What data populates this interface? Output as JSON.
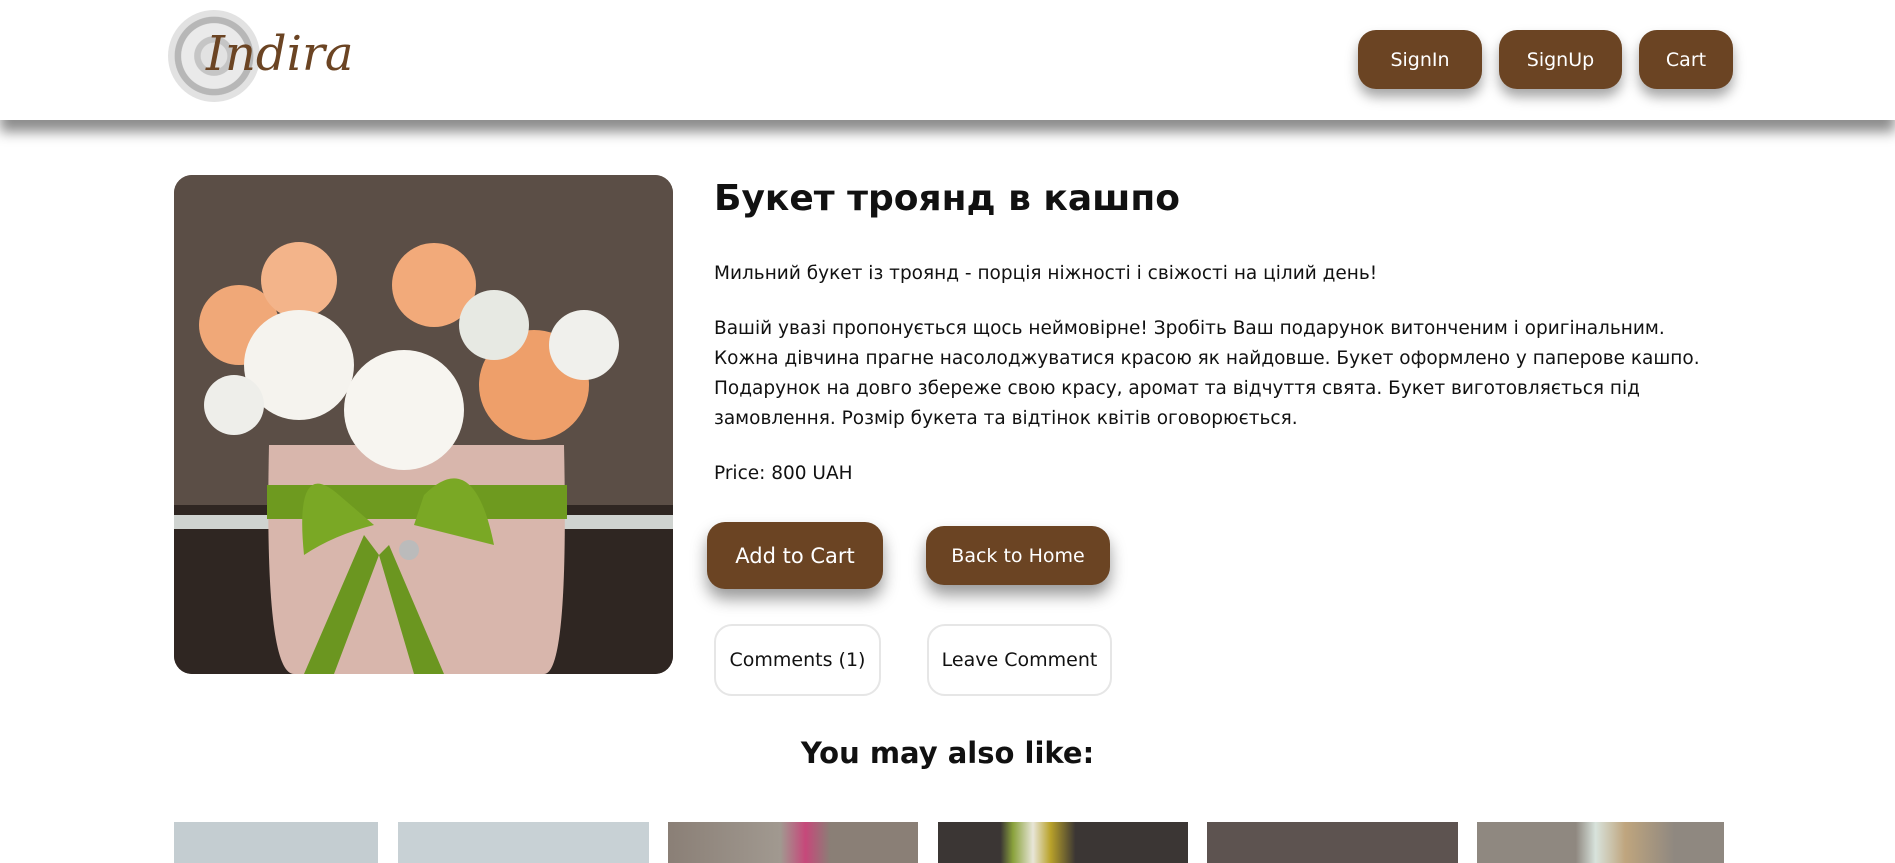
{
  "header": {
    "logo_text": "Indira",
    "nav": [
      {
        "label": "SignIn"
      },
      {
        "label": "SignUp"
      },
      {
        "label": "Cart"
      }
    ]
  },
  "product": {
    "title": "Букет троянд в кашпо",
    "tagline": "Мильний букет із троянд - порція ніжності і свіжості на цілий день!",
    "description": "Вашій увазі пропонується щось неймовірне! Зробіть Ваш подарунок витонченим і оригінальним. Кожна дівчина прагне насолоджуватися красою як найдовше. Букет оформлено у паперове кашпо. Подарунок на довго збереже свою красу, аромат та відчуття свята. Букет виготовляється під замовлення. Розмір букета та відтінок квітів оговорюється.",
    "price": "Price: 800 UAH",
    "add_to_cart": "Add to Cart",
    "back_home": "Back to Home",
    "comments": "Comments (1)",
    "leave_comment": "Leave Comment"
  },
  "recommendations": {
    "heading": "You may also like:"
  },
  "colors": {
    "brand": "#6b4423"
  }
}
